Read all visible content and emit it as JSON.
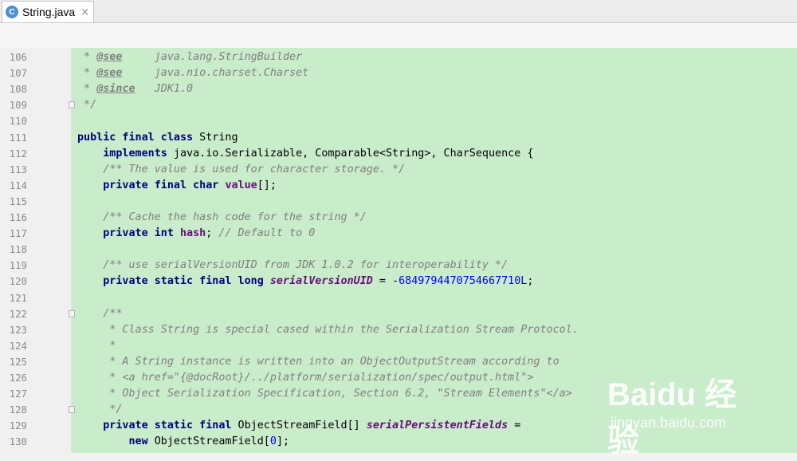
{
  "tab": {
    "icon": "java-class-icon",
    "icon_glyph": "C",
    "title": "String.java",
    "close_glyph": "×"
  },
  "editor": {
    "line_numbers": [
      "106",
      "107",
      "108",
      "109",
      "110",
      "111",
      "112",
      "113",
      "114",
      "115",
      "116",
      "117",
      "118",
      "119",
      "120",
      "121",
      "122",
      "123",
      "124",
      "125",
      "126",
      "127",
      "128",
      "129",
      "130"
    ],
    "lines": [
      {
        "parts": [
          {
            "c": "cm",
            "t": " * "
          },
          {
            "c": "dt",
            "t": "@see"
          },
          {
            "c": "cm",
            "t": "     java.lang.StringBuilder"
          }
        ]
      },
      {
        "parts": [
          {
            "c": "cm",
            "t": " * "
          },
          {
            "c": "dt",
            "t": "@see"
          },
          {
            "c": "cm",
            "t": "     java.nio.charset.Charset"
          }
        ]
      },
      {
        "parts": [
          {
            "c": "cm",
            "t": " * "
          },
          {
            "c": "dt",
            "t": "@since"
          },
          {
            "c": "cm",
            "t": "   JDK1.0"
          }
        ]
      },
      {
        "parts": [
          {
            "c": "cm",
            "t": " */"
          }
        ]
      },
      {
        "parts": []
      },
      {
        "parts": [
          {
            "c": "kw",
            "t": "public final class"
          },
          {
            "c": "",
            "t": " String"
          }
        ]
      },
      {
        "parts": [
          {
            "c": "",
            "t": "    "
          },
          {
            "c": "kw",
            "t": "implements"
          },
          {
            "c": "",
            "t": " java.io.Serializable, Comparable<String>, CharSequence {"
          }
        ]
      },
      {
        "parts": [
          {
            "c": "cm",
            "t": "    /** The value is used for character storage. */"
          }
        ]
      },
      {
        "parts": [
          {
            "c": "",
            "t": "    "
          },
          {
            "c": "kw",
            "t": "private final char"
          },
          {
            "c": "",
            "t": " "
          },
          {
            "c": "fld",
            "t": "value"
          },
          {
            "c": "",
            "t": "[];"
          }
        ]
      },
      {
        "parts": []
      },
      {
        "parts": [
          {
            "c": "cm",
            "t": "    /** Cache the hash code for the string */"
          }
        ]
      },
      {
        "parts": [
          {
            "c": "",
            "t": "    "
          },
          {
            "c": "kw",
            "t": "private int"
          },
          {
            "c": "",
            "t": " "
          },
          {
            "c": "fld",
            "t": "hash"
          },
          {
            "c": "",
            "t": "; "
          },
          {
            "c": "cm",
            "t": "// Default to 0"
          }
        ]
      },
      {
        "parts": []
      },
      {
        "parts": [
          {
            "c": "cm",
            "t": "    /** use serialVersionUID from JDK 1.0.2 for interoperability */"
          }
        ]
      },
      {
        "parts": [
          {
            "c": "",
            "t": "    "
          },
          {
            "c": "kw",
            "t": "private static final long"
          },
          {
            "c": "",
            "t": " "
          },
          {
            "c": "fli",
            "t": "serialVersionUID"
          },
          {
            "c": "",
            "t": " = -"
          },
          {
            "c": "num",
            "t": "6849794470754667710L"
          },
          {
            "c": "",
            "t": ";"
          }
        ]
      },
      {
        "parts": []
      },
      {
        "parts": [
          {
            "c": "cm",
            "t": "    /**"
          }
        ]
      },
      {
        "parts": [
          {
            "c": "cm",
            "t": "     * Class String is special cased within the Serialization Stream Protocol."
          }
        ]
      },
      {
        "parts": [
          {
            "c": "cm",
            "t": "     *"
          }
        ]
      },
      {
        "parts": [
          {
            "c": "cm",
            "t": "     * A String instance is written into an ObjectOutputStream according to"
          }
        ]
      },
      {
        "parts": [
          {
            "c": "cm",
            "t": "     * <a href=\"{@docRoot}/../platform/serialization/spec/output.html\">"
          }
        ]
      },
      {
        "parts": [
          {
            "c": "cm",
            "t": "     * Object Serialization Specification, Section 6.2, \"Stream Elements\"</a>"
          }
        ]
      },
      {
        "parts": [
          {
            "c": "cm",
            "t": "     */"
          }
        ]
      },
      {
        "parts": [
          {
            "c": "",
            "t": "    "
          },
          {
            "c": "kw",
            "t": "private static final"
          },
          {
            "c": "",
            "t": " ObjectStreamField[] "
          },
          {
            "c": "fli",
            "t": "serialPersistentFields"
          },
          {
            "c": "",
            "t": " ="
          }
        ]
      },
      {
        "parts": [
          {
            "c": "",
            "t": "        "
          },
          {
            "c": "kw",
            "t": "new"
          },
          {
            "c": "",
            "t": " ObjectStreamField["
          },
          {
            "c": "num",
            "t": "0"
          },
          {
            "c": "",
            "t": "];"
          }
        ]
      }
    ],
    "fold_lines": [
      "109",
      "122",
      "128"
    ]
  },
  "watermark": {
    "logo_text": "Baidu 经验",
    "url_text": "jingyan.baidu.com"
  },
  "colors": {
    "editor_background": "#c9ecca",
    "keyword": "#000080",
    "comment": "#7f7f7f",
    "field": "#660e7a",
    "number": "#0000ff"
  }
}
